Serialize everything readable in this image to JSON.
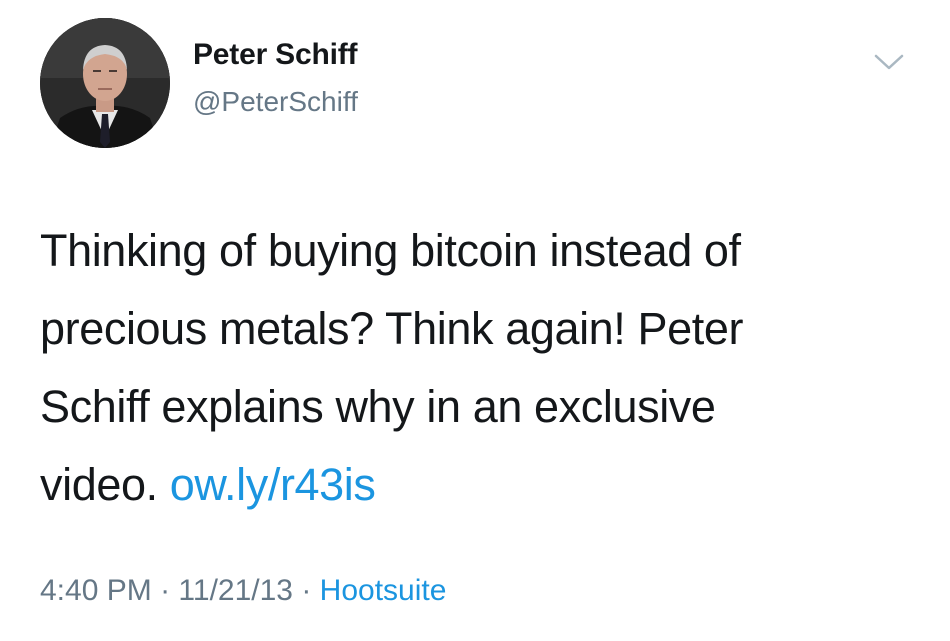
{
  "user": {
    "name": "Peter Schiff",
    "handle": "@PeterSchiff"
  },
  "tweet": {
    "text_line1": "Thinking of buying bitcoin instead of",
    "text_line2": "precious metals? Think again! Peter",
    "text_line3": "Schiff explains why in an exclusive",
    "text_line4_prefix": "video.",
    "link": "ow.ly/r43is"
  },
  "meta": {
    "time": "4:40 PM",
    "separator1": "·",
    "date": "11/21/13",
    "separator2": "·",
    "source": "Hootsuite"
  },
  "icons": {
    "menu": "chevron-down-icon",
    "avatar": "profile-photo"
  },
  "colors": {
    "link": "#1b95e0",
    "secondary_text": "#657786",
    "primary_text": "#14171a"
  }
}
